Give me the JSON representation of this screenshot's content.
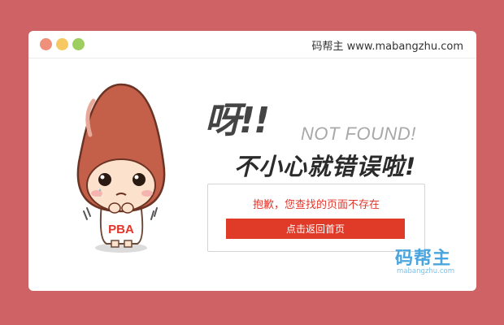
{
  "window": {
    "title": "码帮主 www.mabangzhu.com",
    "controls": [
      "close",
      "minimize",
      "maximize"
    ]
  },
  "mascot": {
    "badge_text": "PBA"
  },
  "error": {
    "exclaim": "呀!!",
    "not_found": "NOT FOUND!",
    "subheadline": "不小心就错误啦!",
    "message": "抱歉，您查找的页面不存在",
    "home_button": "点击返回首页"
  },
  "logo": {
    "chinese": "码帮主",
    "site": "mabangzhu.com"
  },
  "colors": {
    "background": "#cf6265",
    "accent": "#e03b29",
    "message": "#e2362b"
  }
}
